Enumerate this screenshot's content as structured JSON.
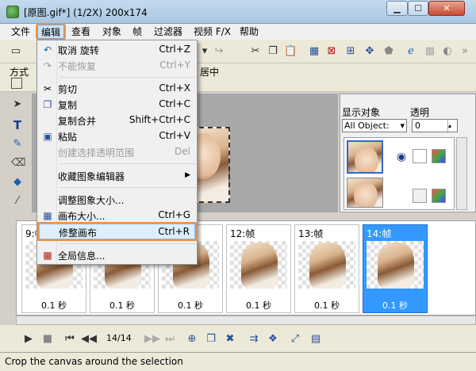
{
  "window": {
    "title": "[原图.gif*] (1/2X)  200x174",
    "icon": "app-icon",
    "controls": {
      "minimize": "▁",
      "maximize": "☐",
      "close": "✕"
    }
  },
  "menubar": {
    "items": [
      "文件",
      "编辑",
      "查看",
      "对象",
      "帧",
      "过滤器",
      "视频 F/X",
      "帮助"
    ]
  },
  "toolbar": {
    "icons": [
      "new-icon",
      "redo-icon",
      "cut-icon",
      "copy-icon",
      "paste-icon",
      "canvas-icon",
      "crop-icon",
      "trim-icon",
      "effect-icon",
      "web-icon",
      "disabled-icon",
      "help-icon"
    ]
  },
  "options_bar": {
    "label": "方式",
    "right_text": "居中"
  },
  "edit_menu": {
    "items": [
      {
        "label": "取消 旋转",
        "shortcut": "Ctrl+Z",
        "icon": "undo-icon",
        "disabled": false
      },
      {
        "label": "不能恢复",
        "shortcut": "Ctrl+Y",
        "icon": "redo-icon",
        "disabled": true
      },
      {
        "label": "剪切",
        "shortcut": "Ctrl+X",
        "icon": "cut-icon",
        "disabled": false
      },
      {
        "label": "复制",
        "shortcut": "Ctrl+C",
        "icon": "copy-icon",
        "disabled": false
      },
      {
        "label": "复制合并",
        "shortcut": "Shift+Ctrl+C",
        "icon": "",
        "disabled": false
      },
      {
        "label": "粘贴",
        "shortcut": "Ctrl+V",
        "icon": "paste-icon",
        "disabled": false
      },
      {
        "label": "创建选择透明范围",
        "shortcut": "Del",
        "icon": "",
        "disabled": true
      },
      {
        "label": "收藏图象编辑器",
        "shortcut": "▶",
        "icon": "",
        "disabled": false
      },
      {
        "label": "调整图象大小...",
        "shortcut": "",
        "icon": "",
        "disabled": false
      },
      {
        "label": "画布大小...",
        "shortcut": "Ctrl+G",
        "icon": "canvas-size-icon",
        "disabled": false
      },
      {
        "label": "修整画布",
        "shortcut": "Ctrl+R",
        "icon": "",
        "disabled": false
      },
      {
        "label": "全局信息...",
        "shortcut": "",
        "icon": "info-icon",
        "disabled": false
      }
    ]
  },
  "object_panel": {
    "display_label": "显示对象",
    "transparency_label": "透明",
    "display_value": "All Object:",
    "transparency_value": "0"
  },
  "frames": [
    {
      "header": "9:帧",
      "duration": "0.1 秒",
      "selected": false
    },
    {
      "header": "",
      "duration": "0.1 秒",
      "selected": false
    },
    {
      "header": "",
      "duration": "0.1 秒",
      "selected": false
    },
    {
      "header": "12:帧",
      "duration": "0.1 秒",
      "selected": false
    },
    {
      "header": "13:帧",
      "duration": "0.1 秒",
      "selected": false
    },
    {
      "header": "14:帧",
      "duration": "0.1 秒",
      "selected": true
    }
  ],
  "playback": {
    "frame_counter": "14/14"
  },
  "status": {
    "text": "Crop the canvas around the selection"
  }
}
